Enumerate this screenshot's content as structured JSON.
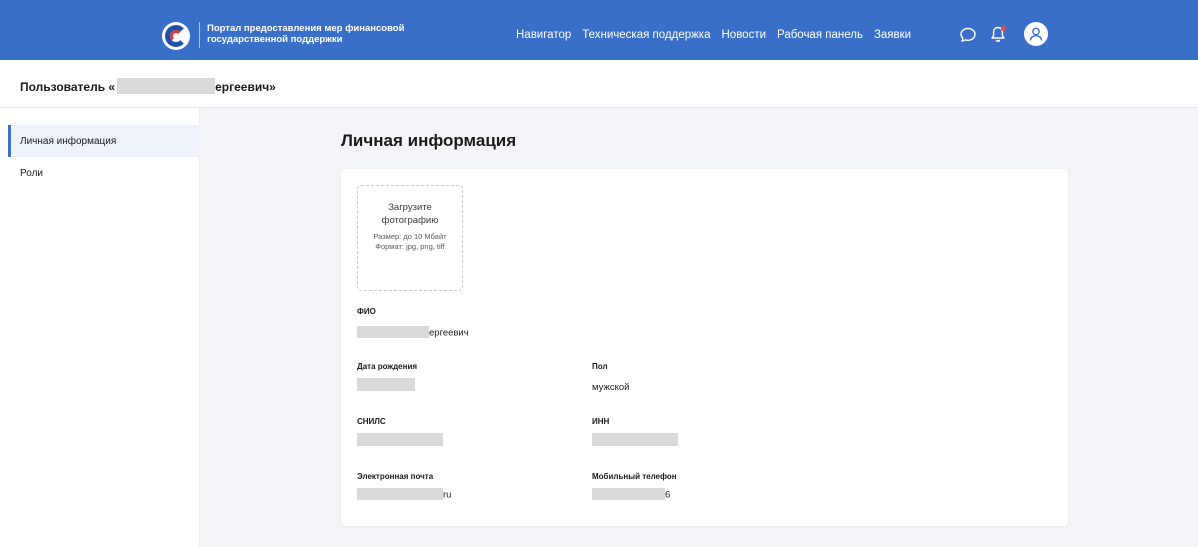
{
  "header": {
    "portal_title_line1": "Портал предоставления мер финансовой",
    "portal_title_line2": "государственной поддержки",
    "nav": [
      "Навигатор",
      "Техническая поддержка",
      "Новости",
      "Рабочая панель",
      "Заявки"
    ],
    "accent_color": "#3a6fc9"
  },
  "userbar": {
    "prefix": "Пользователь «",
    "suffix": "ергеевич»"
  },
  "sidebar": {
    "items": [
      {
        "label": "Личная информация",
        "active": true
      },
      {
        "label": "Роли",
        "active": false
      }
    ]
  },
  "main": {
    "title": "Личная информация",
    "upload": {
      "title": "Загрузите фотографию",
      "size": "Размер: до 10 Мбайт",
      "format": "Формат: jpg, png, tiff"
    },
    "fields": {
      "fio_label": "ФИО",
      "fio_value_suffix": "ергеевич",
      "birth_label": "Дата рождения",
      "gender_label": "Пол",
      "gender_value": "мужской",
      "snils_label": "СНИЛС",
      "inn_label": "ИНН",
      "email_label": "Электронная почта",
      "email_value_suffix": "ru",
      "phone_label": "Мобильный телефон",
      "phone_value_suffix": "6"
    }
  }
}
